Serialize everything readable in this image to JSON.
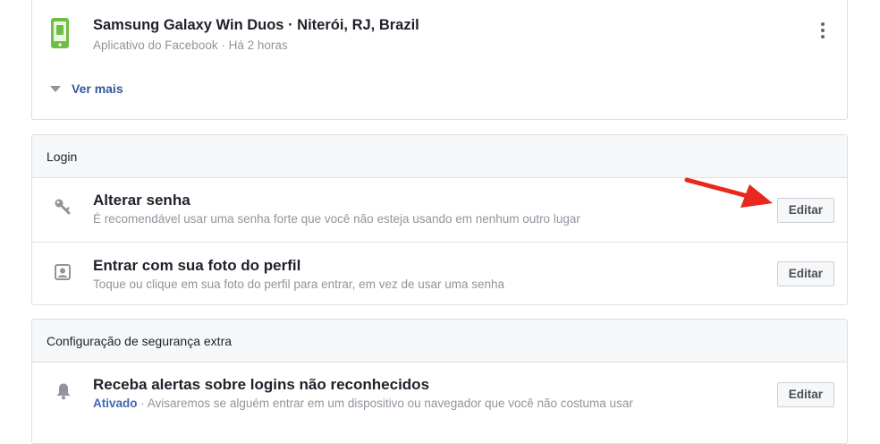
{
  "sessions": {
    "device_title": "Samsung Galaxy Win Duos · Niterói, RJ, Brazil",
    "device_meta": "Aplicativo do Facebook · Há 2 horas",
    "see_more": "Ver mais"
  },
  "login": {
    "header": "Login",
    "items": [
      {
        "title": "Alterar senha",
        "subtitle": "É recomendável usar uma senha forte que você não esteja usando em nenhum outro lugar",
        "button": "Editar",
        "icon": "key-icon"
      },
      {
        "title": "Entrar com sua foto do perfil",
        "subtitle": "Toque ou clique em sua foto do perfil para entrar, em vez de usar uma senha",
        "button": "Editar",
        "icon": "profile-photo-icon"
      }
    ]
  },
  "extra_security": {
    "header": "Configuração de segurança extra",
    "items": [
      {
        "title": "Receba alertas sobre logins não reconhecidos",
        "status": "Ativado",
        "subtitle": "· Avisaremos se alguém entrar em um dispositivo ou navegador que você não costuma usar",
        "button": "Editar",
        "icon": "bell-icon"
      }
    ]
  },
  "colors": {
    "annotation_arrow": "#e8281e",
    "link": "#365899"
  }
}
